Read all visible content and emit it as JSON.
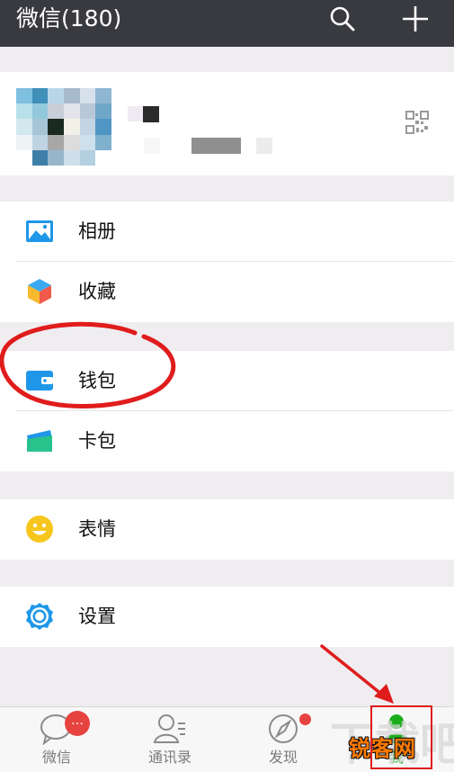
{
  "header": {
    "title": "微信(180)",
    "search_icon": "search-icon",
    "add_icon": "plus-icon"
  },
  "profile": {
    "avatar": "pixelated-avatar",
    "qr_icon": "qr-code-icon"
  },
  "menu": {
    "group1": [
      {
        "label": "相册",
        "icon": "album-icon"
      },
      {
        "label": "收藏",
        "icon": "favorites-icon"
      }
    ],
    "group2": [
      {
        "label": "钱包",
        "icon": "wallet-icon"
      },
      {
        "label": "卡包",
        "icon": "card-pack-icon"
      }
    ],
    "group3": [
      {
        "label": "表情",
        "icon": "sticker-icon"
      }
    ],
    "group4": [
      {
        "label": "设置",
        "icon": "gear-icon"
      }
    ]
  },
  "tabs": [
    {
      "label": "微信",
      "icon": "chat-icon",
      "badge": "…"
    },
    {
      "label": "通讯录",
      "icon": "contacts-icon"
    },
    {
      "label": "发现",
      "icon": "compass-icon",
      "dot": true
    },
    {
      "label": "我",
      "icon": "person-icon",
      "active": true
    }
  ],
  "watermark": {
    "text": "锐客网"
  },
  "colors": {
    "topbar": "#393a3f",
    "accent_green": "#1aad19",
    "badge_red": "#e64340",
    "annotation_red": "#e01c1c",
    "icon_blue": "#1f97e8"
  }
}
